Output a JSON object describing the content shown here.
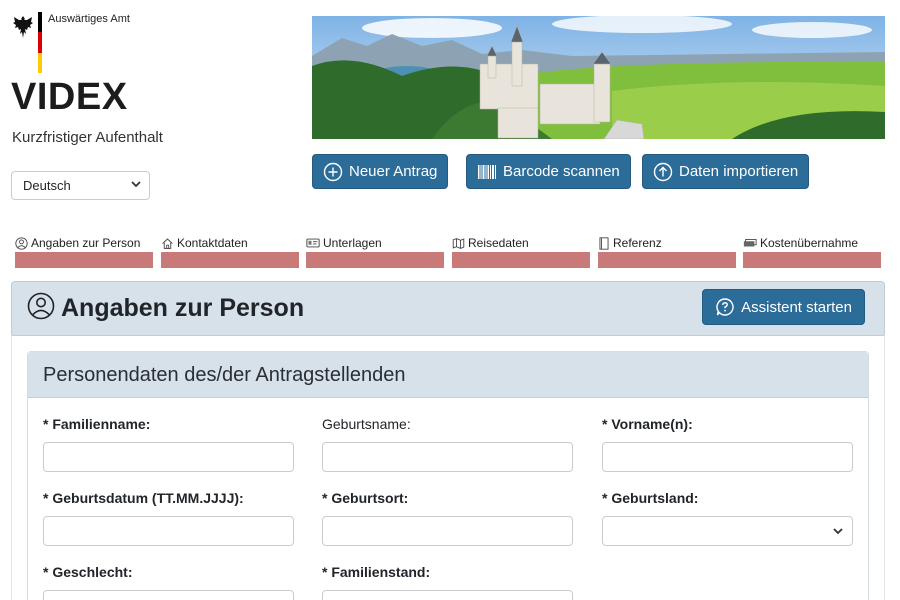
{
  "header": {
    "ministry": "Auswärtiges Amt",
    "app_title": "VIDEX",
    "app_subtitle": "Kurzfristiger Aufenthalt",
    "language": {
      "selected": "Deutsch"
    }
  },
  "actions": [
    {
      "label": "Neuer Antrag",
      "icon": "plus-circle-icon"
    },
    {
      "label": "Barcode scannen",
      "icon": "barcode-icon"
    },
    {
      "label": "Daten importieren",
      "icon": "upload-circle-icon"
    }
  ],
  "steps": [
    {
      "label": "Angaben zur Person",
      "icon": "person-circle-icon"
    },
    {
      "label": "Kontaktdaten",
      "icon": "house-icon"
    },
    {
      "label": "Unterlagen",
      "icon": "id-card-icon"
    },
    {
      "label": "Reisedaten",
      "icon": "map-icon"
    },
    {
      "label": "Referenz",
      "icon": "document-icon"
    },
    {
      "label": "Kostenübernahme",
      "icon": "money-icon"
    }
  ],
  "section": {
    "title": "Angaben zur Person",
    "icon": "person-circle-icon",
    "assistant_button": "Assistent starten"
  },
  "card": {
    "title": "Personendaten des/der Antragstellenden",
    "fields": [
      {
        "label": "* Familienname:",
        "required": true,
        "value": ""
      },
      {
        "label": "Geburtsname:",
        "required": false,
        "value": ""
      },
      {
        "label": "* Vorname(n):",
        "required": true,
        "value": ""
      },
      {
        "label": "* Geburtsdatum (TT.MM.JJJJ):",
        "required": true,
        "value": ""
      },
      {
        "label": "* Geburtsort:",
        "required": true,
        "value": ""
      },
      {
        "label": "* Geburtsland:",
        "required": true,
        "value": "",
        "type": "select"
      },
      {
        "label": "* Geschlecht:",
        "required": true,
        "value": ""
      },
      {
        "label": "* Familienstand:",
        "required": true,
        "value": ""
      }
    ]
  },
  "colors": {
    "primary_button": "#2c6c99",
    "header_panel": "#d6e1ea",
    "step_bar": "#c87a78",
    "flag": [
      "#000000",
      "#dd0000",
      "#ffcc00"
    ]
  }
}
